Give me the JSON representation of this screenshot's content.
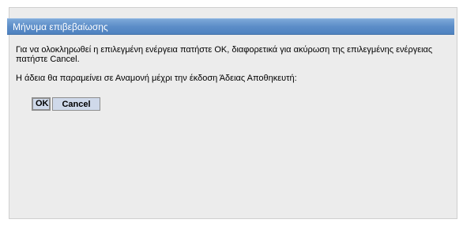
{
  "dialog": {
    "title": "Μήνυμα επιβεβαίωσης",
    "message": "Για να ολοκληρωθεί η επιλεγμένη ενέργεια πατήστε OK, διαφορετικά για ακύρωση της επιλεγμένης ενέργειας πατήστε Cancel.",
    "info": "Η άδεια θα παραμείνει σε Αναμονή μέχρι την έκδοση Άδειας Αποθηκευτή:",
    "ok_label": "OK",
    "cancel_label": "Cancel"
  },
  "colors": {
    "titlebar": "#5c8dc8",
    "dialog_background": "#ececec",
    "button_background": "#cfd9ea"
  }
}
